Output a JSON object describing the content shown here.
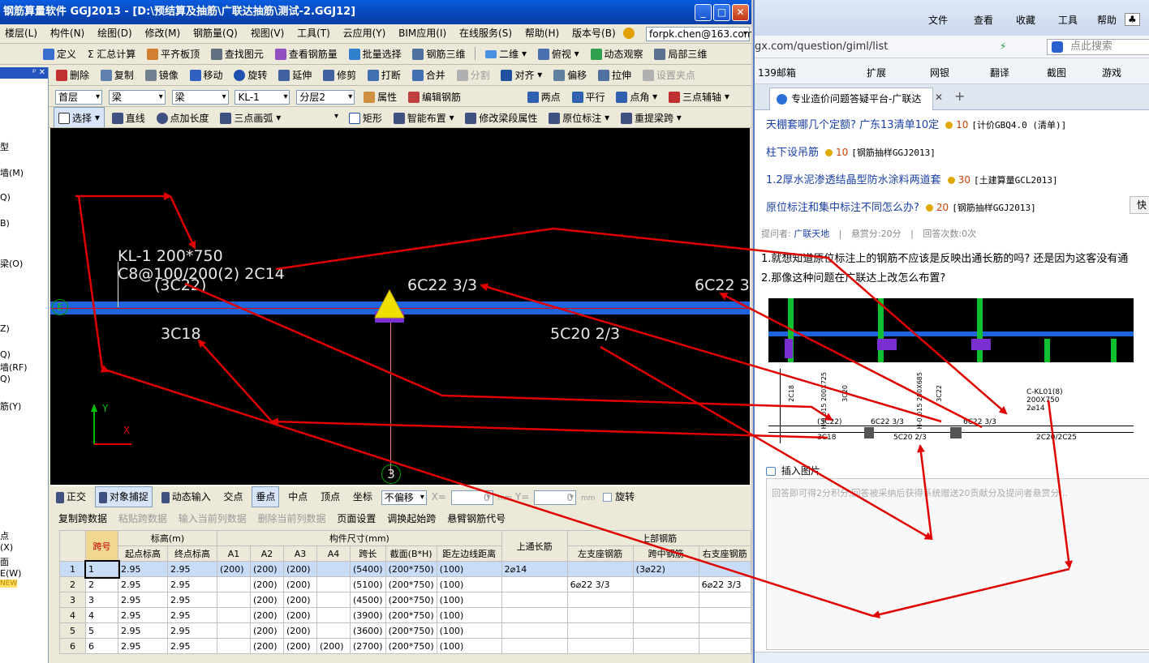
{
  "app": {
    "title": "钢筋算量软件 GGJ2013 - [D:\\预结算及抽筋\\广联达抽筋\\测试-2.GGJ12]",
    "menu": [
      "楼层(L)",
      "构件(N)",
      "绘图(D)",
      "修改(M)",
      "钢筋量(Q)",
      "视图(V)",
      "工具(T)",
      "云应用(Y)",
      "BIM应用(I)",
      "在线服务(S)",
      "帮助(H)",
      "版本号(B)"
    ],
    "user_email": "forpk.chen@163.com",
    "toolbar1": [
      "定义",
      "Σ 汇总计算",
      "平齐板顶",
      "查找图元",
      "查看钢筋量",
      "批量选择",
      "钢筋三维",
      "二维",
      "俯视",
      "动态观察",
      "局部三维"
    ],
    "toolbar2": [
      "删除",
      "复制",
      "镜像",
      "移动",
      "旋转",
      "延伸",
      "修剪",
      "打断",
      "合并",
      "分割",
      "对齐",
      "偏移",
      "拉伸",
      "设置夹点"
    ],
    "toolbar3": {
      "floor": "首层",
      "category": "梁",
      "type": "梁",
      "element": "KL-1",
      "layer": "分层2",
      "props": "属性",
      "edit_rebar": "编辑钢筋",
      "two_points": "两点",
      "parallel": "平行",
      "point_angle": "点角",
      "three_point_aux": "三点辅轴"
    },
    "toolbar4": [
      "选择",
      "直线",
      "点加长度",
      "三点画弧",
      "矩形",
      "智能布置",
      "修改梁段属性",
      "原位标注",
      "重提梁跨"
    ],
    "left_panel_items": [
      "型",
      "墙(M)",
      "Q)",
      "B)",
      "梁(O)",
      "Z)",
      "Q)",
      "墙(RF)",
      "Q)",
      "筋(Y)",
      "点",
      "(X)",
      "面",
      "E(W)",
      "NEW"
    ],
    "canvas": {
      "beam_label_line1": "KL-1 200*750",
      "beam_label_line2": "C8@100/200(2) 2C14",
      "beam_label_line3": "(3C22)",
      "top_label_1": "6C22 3/3",
      "top_label_2": "6C22 3",
      "bottom_label_1": "3C18",
      "bottom_label_2": "5C20 2/3",
      "axis_e": "E",
      "axis_3": "3",
      "y_axis": "Y",
      "x_axis": "X"
    },
    "snapbar": {
      "items": [
        "正交",
        "对象捕捉",
        "动态输入",
        "交点",
        "垂点",
        "中点",
        "顶点",
        "坐标"
      ],
      "mode": "不偏移",
      "x_label": "X=",
      "x_value": "0",
      "y_label": "Y=",
      "y_value": "0",
      "unit": "mm",
      "rotate": "旋转"
    },
    "grid_toolbar": [
      "复制跨数据",
      "粘贴跨数据",
      "输入当前列数据",
      "删除当前列数据",
      "页面设置",
      "调换起始跨",
      "悬臂钢筋代号"
    ],
    "grid_toolbar_disabled": [
      false,
      true,
      true,
      true,
      false,
      false,
      false
    ],
    "table": {
      "h_span": "跨号",
      "h_elev": "标高(m)",
      "h_size": "构件尺寸(mm)",
      "h_top_through": "上通长筋",
      "h_top_rebar": "上部钢筋",
      "h_start_elev": "起点标高",
      "h_end_elev": "终点标高",
      "h_a1": "A1",
      "h_a2": "A2",
      "h_a3": "A3",
      "h_a4": "A4",
      "h_length": "跨长",
      "h_section": "截面(B*H)",
      "h_edge": "距左边线距离",
      "h_left_support": "左支座钢筋",
      "h_mid": "跨中钢筋",
      "h_right_support": "右支座钢筋",
      "rows": [
        [
          "1",
          "1",
          "2.95",
          "2.95",
          "(200)",
          "(200)",
          "(200)",
          "",
          "(5400)",
          "(200*750)",
          "(100)",
          "2⌀14",
          "",
          "(3⌀22)",
          ""
        ],
        [
          "2",
          "2",
          "2.95",
          "2.95",
          "",
          "(200)",
          "(200)",
          "",
          "(5100)",
          "(200*750)",
          "(100)",
          "",
          "6⌀22 3/3",
          "",
          "6⌀22 3/3"
        ],
        [
          "3",
          "3",
          "2.95",
          "2.95",
          "",
          "(200)",
          "(200)",
          "",
          "(4500)",
          "(200*750)",
          "(100)",
          "",
          "",
          "",
          ""
        ],
        [
          "4",
          "4",
          "2.95",
          "2.95",
          "",
          "(200)",
          "(200)",
          "",
          "(3900)",
          "(200*750)",
          "(100)",
          "",
          "",
          "",
          ""
        ],
        [
          "5",
          "5",
          "2.95",
          "2.95",
          "",
          "(200)",
          "(200)",
          "",
          "(3600)",
          "(200*750)",
          "(100)",
          "",
          "",
          "",
          ""
        ],
        [
          "6",
          "6",
          "2.95",
          "2.95",
          "",
          "(200)",
          "(200)",
          "(200)",
          "(2700)",
          "(200*750)",
          "(100)",
          "",
          "",
          "",
          ""
        ]
      ]
    }
  },
  "browser": {
    "menu": [
      "文件",
      "查看",
      "收藏",
      "工具",
      "帮助"
    ],
    "url": "gx.com/question/giml/list",
    "search_placeholder": "点此搜索",
    "favorites": [
      "139邮箱",
      "扩展",
      "网银",
      "翻译",
      "截图",
      "游戏"
    ],
    "tab_title": "专业造价问题答疑平台-广联达",
    "questions": [
      {
        "title": "天棚套哪几个定额? 广东13清单10定",
        "points": "10",
        "category": "[计价GBQ4.0 (清单)]"
      },
      {
        "title": "柱下设吊筋",
        "points": "10",
        "category": "[钢筋抽样GGJ2013]"
      },
      {
        "title": "1.2厚水泥渗透结晶型防水涂料两道套",
        "points": "30",
        "category": "[土建算量GCL2013]"
      },
      {
        "title": "原位标注和集中标注不同怎么办?",
        "points": "20",
        "category": "[钢筋抽样GGJ2013]"
      }
    ],
    "meta": {
      "asker_label": "提问者:",
      "asker": "广联天地",
      "reward": "悬赏分:20分",
      "answers": "回答次数:0次"
    },
    "body_line1": "1.就想知道原位标注上的钢筋不应该是反映出通长筋的吗? 还是因为这客没有通",
    "body_line2": "2.那像这种问题在广联达上改怎么布置?",
    "drawing": {
      "label_kl": "C-KL01(8)",
      "label_size": "200X750",
      "label_rebar": "2⌀14",
      "label_3c22": "(3C22)",
      "label_6c22_a": "6C22 3/3",
      "label_6c22_b": "6C22 3/3",
      "label_3c18": "3C18",
      "label_5c20": "5C20 2/3",
      "label_2c20": "2C20/2C25",
      "elev_1": "H-0.015 200X725",
      "elev_2": "H-0.015 200X685",
      "rebar_2c18": "2C18",
      "rebar_3c20": "3C20",
      "rebar_3c22": "3C22"
    },
    "insert_image": "插入图片",
    "answer_placeholder": "回答即可得2分积分,回答被采纳后获得系统赠送20贡献分及提问者悬赏分...",
    "side_button": "快"
  },
  "colors": {
    "canvas_bg": "#000000",
    "beam_blue": "#1e64dc",
    "annotation_red": "#e00000",
    "column_yellow": "#f0e000",
    "column_purple": "#7a2fd0",
    "axis_green": "#00c000",
    "title_blue": "#0a5de0"
  }
}
